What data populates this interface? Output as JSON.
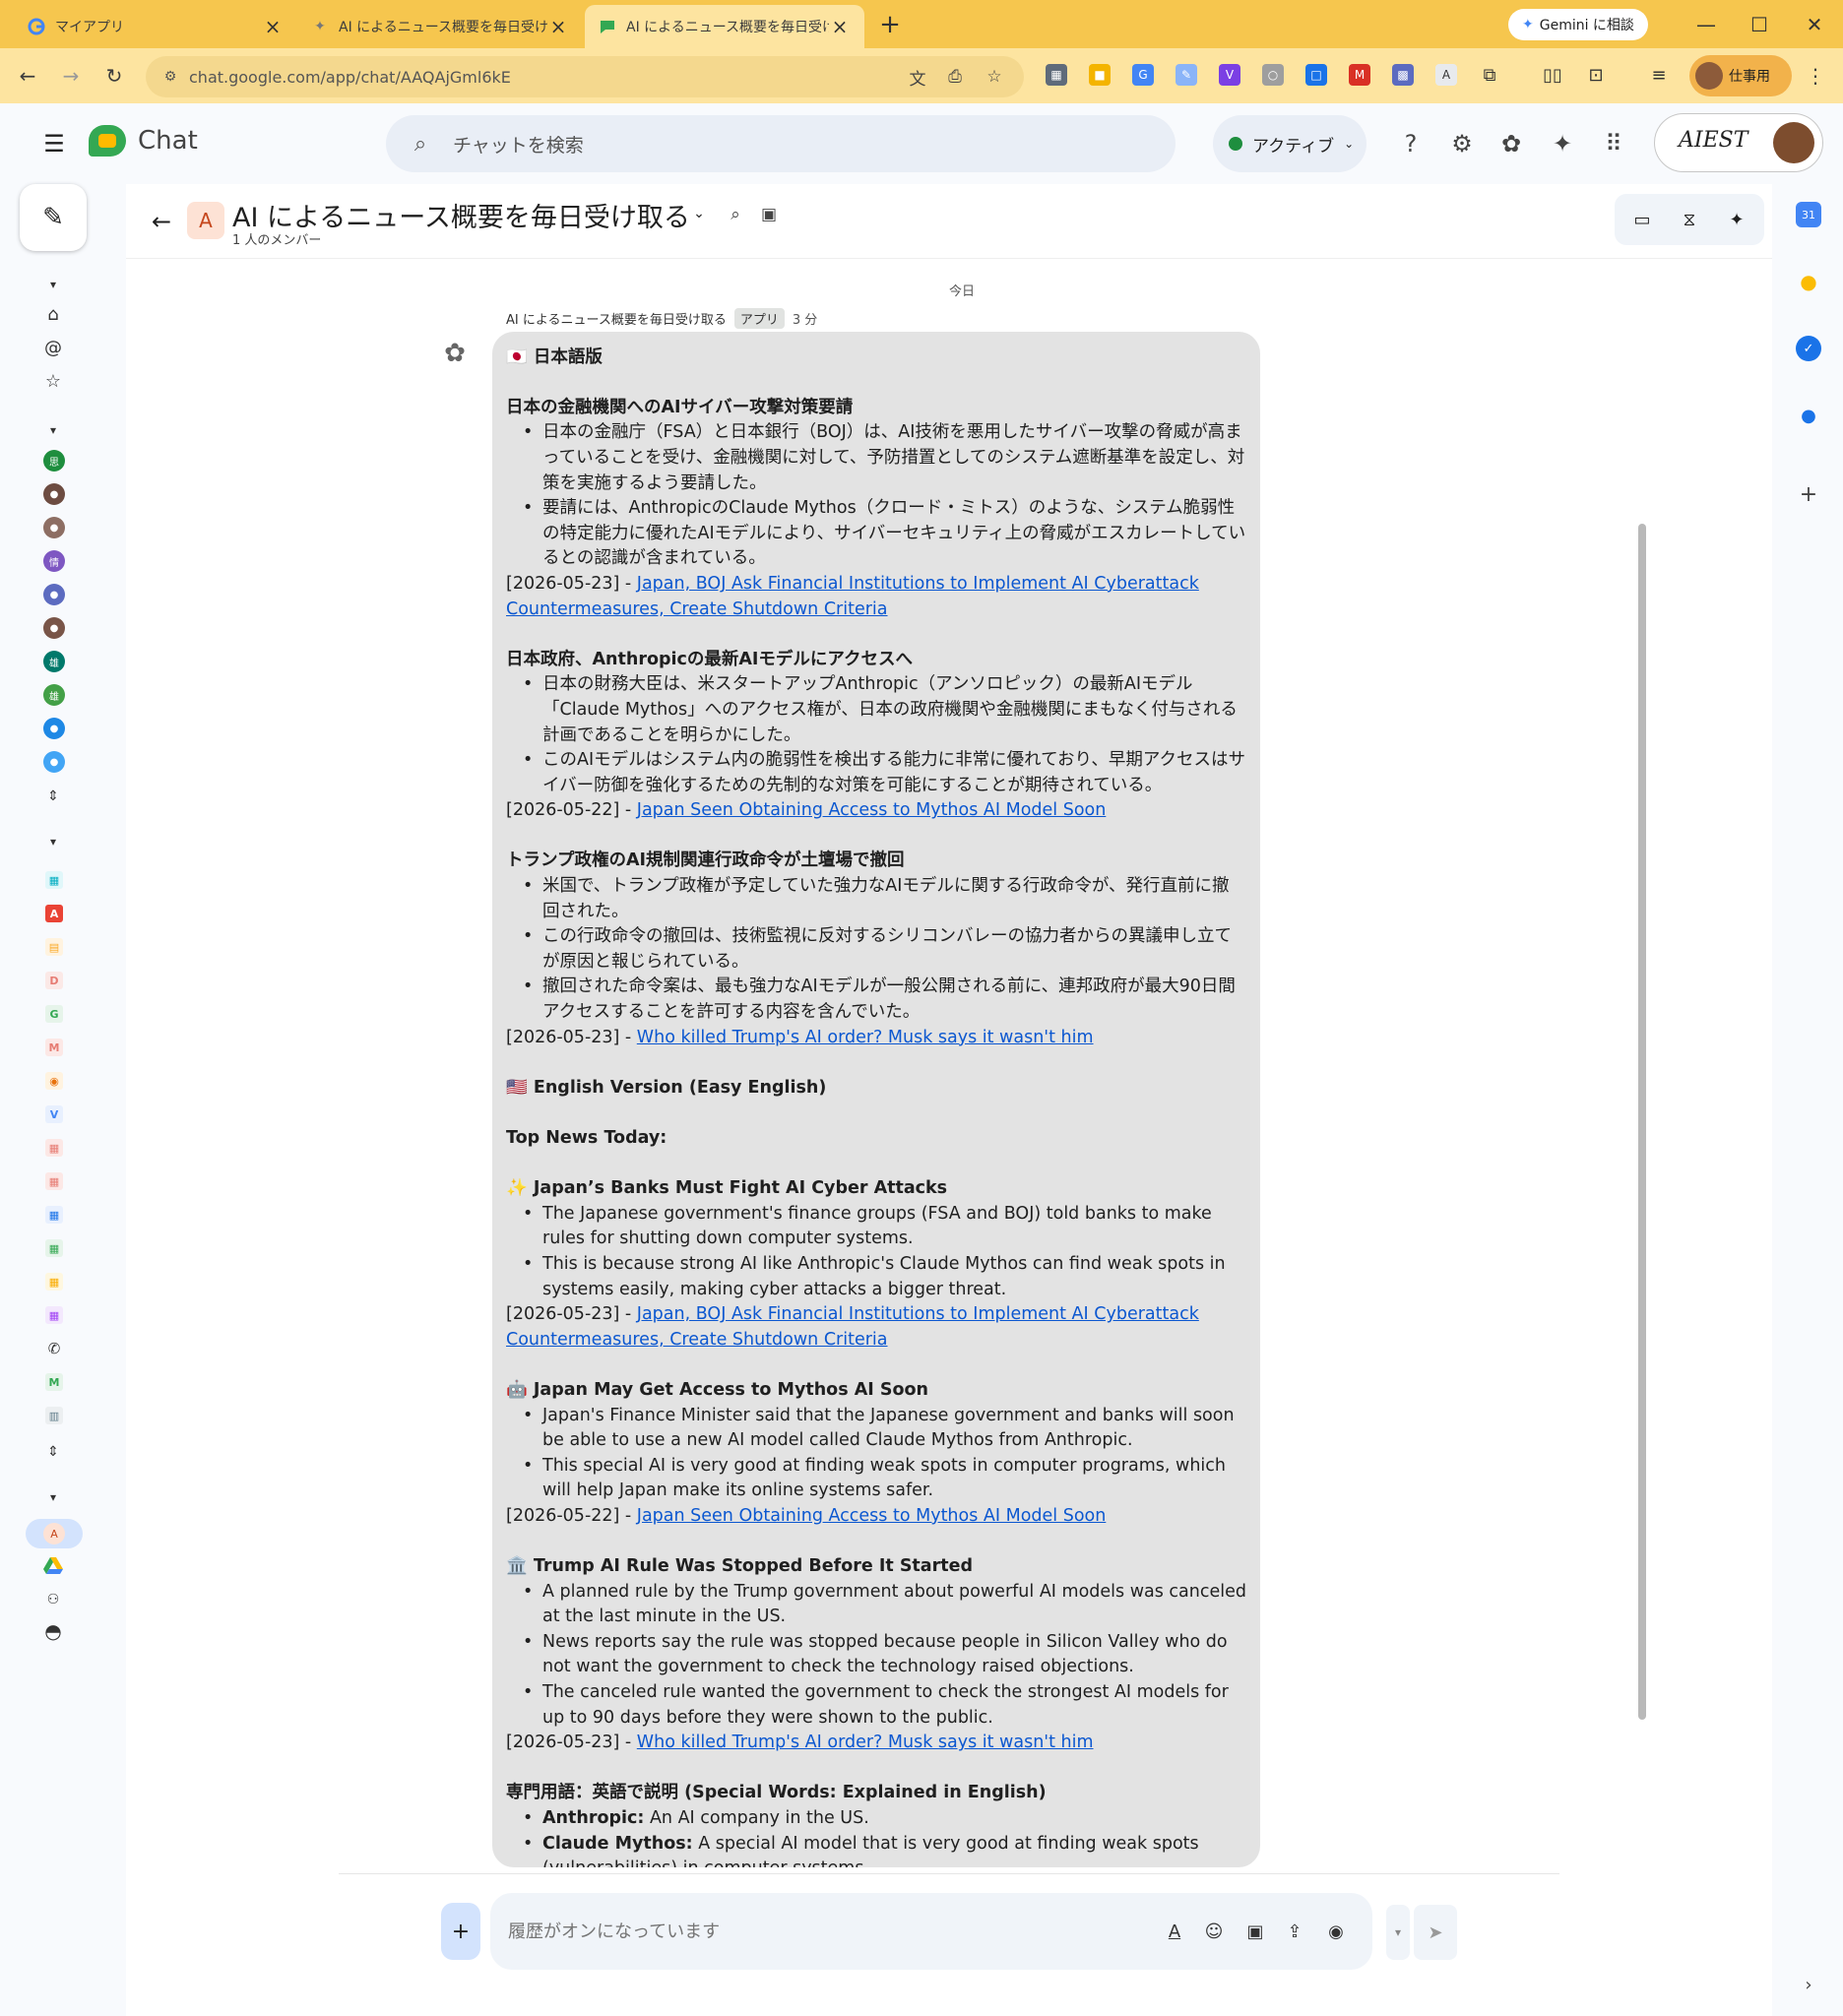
{
  "browser": {
    "tabs": [
      {
        "title": "マイアプリ",
        "favicon": "google-g-icon",
        "active": false
      },
      {
        "title": "AI によるニュース概要を毎日受け取る",
        "favicon": "bot-icon",
        "active": false
      },
      {
        "title": "AI によるニュース概要を毎日受け取る",
        "favicon": "chat-icon",
        "active": true
      }
    ],
    "gemini_button": "Gemini に相談",
    "url": "chat.google.com/app/chat/AAQAjGml6kE",
    "profile_label": "仕事用",
    "accent": "#f6c64e"
  },
  "app": {
    "name": "Chat",
    "search_placeholder": "チャットを検索",
    "status": "アクティブ",
    "account_sig": "AIEST"
  },
  "conversation": {
    "avatar_letter": "A",
    "title": "AI によるニュース概要を毎日受け取る",
    "subtitle": "1 人のメンバー",
    "date_divider": "今日",
    "sender": "AI によるニュース概要を毎日受け取る",
    "sender_badge": "アプリ",
    "time": "3 分"
  },
  "message": {
    "jp_header": "🇯🇵 日本語版",
    "sections_jp": [
      {
        "title": "日本の金融機関へのAIサイバー攻撃対策要請",
        "bullets": [
          "日本の金融庁（FSA）と日本銀行（BOJ）は、AI技術を悪用したサイバー攻撃の脅威が高まっていることを受け、金融機関に対して、予防措置としてのシステム遮断基準を設定し、対策を実施するよう要請した。",
          "要請には、AnthropicのClaude Mythos（クロード・ミトス）のような、システム脆弱性の特定能力に優れたAIモデルにより、サイバーセキュリティ上の脅威がエスカレートしているとの認識が含まれている。"
        ],
        "date": "[2026-05-23] - ",
        "link": "Japan, BOJ Ask Financial Institutions to Implement AI Cyberattack Countermeasures, Create Shutdown Criteria"
      },
      {
        "title": "日本政府、Anthropicの最新AIモデルにアクセスへ",
        "bullets": [
          "日本の財務大臣は、米スタートアップAnthropic（アンソロピック）の最新AIモデル「Claude Mythos」へのアクセス権が、日本の政府機関や金融機関にまもなく付与される計画であることを明らかにした。",
          "このAIモデルはシステム内の脆弱性を検出する能力に非常に優れており、早期アクセスはサイバー防御を強化するための先制的な対策を可能にすることが期待されている。"
        ],
        "date": "[2026-05-22] - ",
        "link": "Japan Seen Obtaining Access to Mythos AI Model Soon"
      },
      {
        "title": "トランプ政権のAI規制関連行政命令が土壇場で撤回",
        "bullets": [
          "米国で、トランプ政権が予定していた強力なAIモデルに関する行政命令が、発行直前に撤回された。",
          "この行政命令の撤回は、技術監視に反対するシリコンバレーの協力者からの異議申し立てが原因と報じられている。",
          "撤回された命令案は、最も強力なAIモデルが一般公開される前に、連邦政府が最大90日間アクセスすることを許可する内容を含んでいた。"
        ],
        "date": "[2026-05-23] - ",
        "link": "Who killed Trump's AI order? Musk says it wasn't him"
      }
    ],
    "en_header": "🇺🇸 English Version (Easy English)",
    "en_top": "Top News Today:",
    "sections_en": [
      {
        "title": "✨ Japan’s Banks Must Fight AI Cyber Attacks",
        "bullets": [
          "The Japanese government's finance groups (FSA and BOJ) told banks to make rules for shutting down computer systems.",
          "This is because strong AI like Anthropic's Claude Mythos can find weak spots in systems easily, making cyber attacks a bigger threat."
        ],
        "date": "[2026-05-23] - ",
        "link": "Japan, BOJ Ask Financial Institutions to Implement AI Cyberattack Countermeasures, Create Shutdown Criteria"
      },
      {
        "title": "🤖 Japan May Get Access to Mythos AI Soon",
        "bullets": [
          "Japan's Finance Minister said that the Japanese government and banks will soon be able to use a new AI model called Claude Mythos from Anthropic.",
          "This special AI is very good at finding weak spots in computer programs, which will help Japan make its online systems safer."
        ],
        "date": "[2026-05-22] - ",
        "link": "Japan Seen Obtaining Access to Mythos AI Model Soon"
      },
      {
        "title": "🏛️ Trump AI Rule Was Stopped Before It Started",
        "bullets": [
          "A planned rule by the Trump government about powerful AI models was canceled at the last minute in the US.",
          "News reports say the rule was stopped because people in Silicon Valley who do not want the government to check the technology raised objections.",
          "The canceled rule wanted the government to check the strongest AI models for up to 90 days before they were shown to the public."
        ],
        "date": "[2026-05-23] - ",
        "link": "Who killed Trump's AI order? Musk says it wasn't him"
      }
    ],
    "glossary_header": "専門用語：英語で説明 (Special Words: Explained in English)",
    "glossary": [
      {
        "term": "Anthropic:",
        "def": " An AI company in the US."
      },
      {
        "term": "Claude Mythos:",
        "def": " A special AI model that is very good at finding weak spots (vulnerabilities) in computer systems."
      }
    ]
  },
  "composer": {
    "placeholder": "履歴がオンになっています"
  }
}
